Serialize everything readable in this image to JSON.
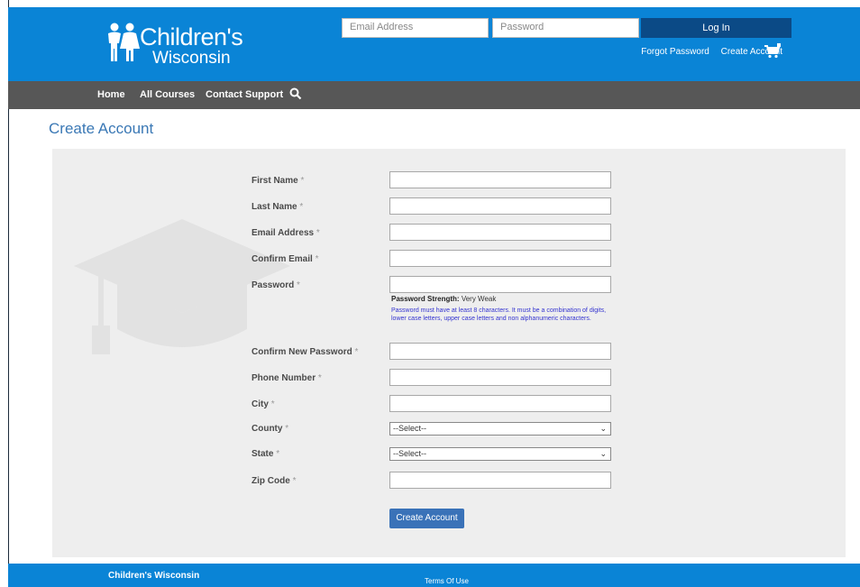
{
  "header": {
    "logo": {
      "line1": "Children's",
      "line2": "Wisconsin"
    },
    "email_placeholder": "Email Address",
    "password_placeholder": "Password",
    "login_label": "Log In",
    "forgot_password": "Forgot Password",
    "create_account_link": "Create Account"
  },
  "nav": {
    "items": [
      "Home",
      "All Courses",
      "Contact Support"
    ]
  },
  "page": {
    "title": "Create Account"
  },
  "form": {
    "fields": {
      "first_name": "First Name",
      "last_name": "Last Name",
      "email": "Email Address",
      "confirm_email": "Confirm Email",
      "password": "Password",
      "confirm_password": "Confirm New Password",
      "phone": "Phone Number",
      "city": "City",
      "county": "County",
      "state": "State",
      "zip": "Zip Code"
    },
    "required_mark": "*",
    "password_strength_label": "Password Strength:",
    "password_strength_value": "Very Weak",
    "password_note": "Password must have at least 8 characters. It must be a combination of digits, lower case letters, upper case letters and non alphanumeric characters.",
    "county_selected": "--Select--",
    "state_selected": "--Select--",
    "submit_label": "Create Account"
  },
  "footer": {
    "brand": "Children's Wisconsin",
    "terms": "Terms Of Use"
  },
  "colors": {
    "header_blue": "#0a84d6",
    "nav_gray": "#575757",
    "login_button": "#0b4a86",
    "title_blue": "#3a78b5",
    "submit_button": "#3a72b8"
  },
  "icons": [
    "logo-children-icon",
    "cart-icon",
    "search-icon",
    "graduation-cap-icon",
    "chevron-down-icon"
  ]
}
